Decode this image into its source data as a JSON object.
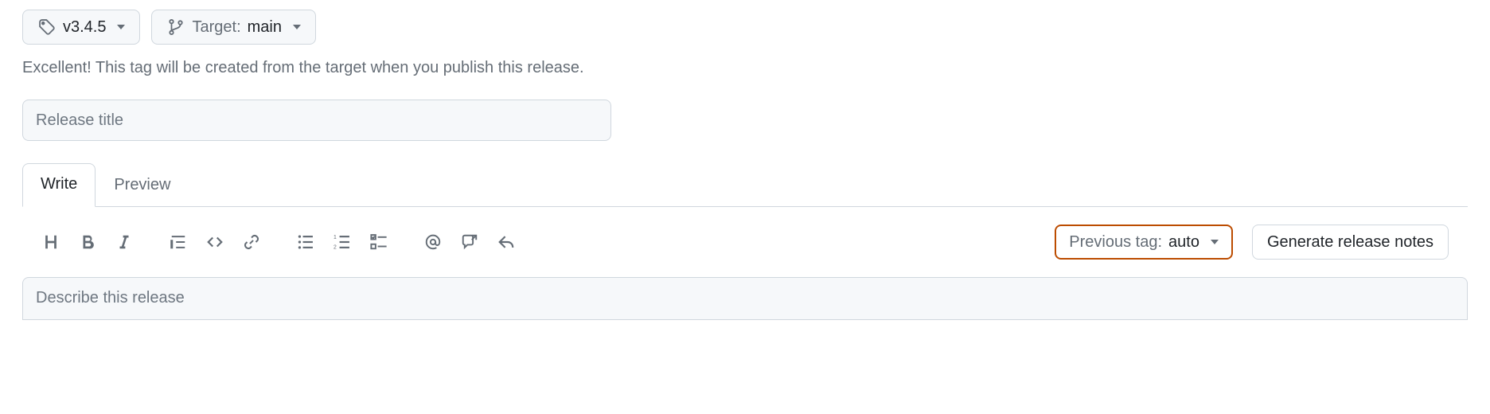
{
  "tagSelector": {
    "tag": "v3.4.5"
  },
  "targetSelector": {
    "label": "Target:",
    "branch": "main"
  },
  "hint": "Excellent! This tag will be created from the target when you publish this release.",
  "titleInput": {
    "placeholder": "Release title"
  },
  "tabs": {
    "write": "Write",
    "preview": "Preview"
  },
  "toolbar": {
    "icons": {
      "heading": "heading-icon",
      "bold": "bold-icon",
      "italic": "italic-icon",
      "quote": "quote-icon",
      "code": "code-icon",
      "link": "link-icon",
      "ul": "unordered-list-icon",
      "ol": "ordered-list-icon",
      "task": "task-list-icon",
      "mention": "mention-icon",
      "crossref": "cross-reference-icon",
      "reply": "reply-icon"
    }
  },
  "previousTag": {
    "label": "Previous tag:",
    "value": "auto"
  },
  "generateNotes": {
    "label": "Generate release notes"
  },
  "description": {
    "placeholder": "Describe this release"
  }
}
